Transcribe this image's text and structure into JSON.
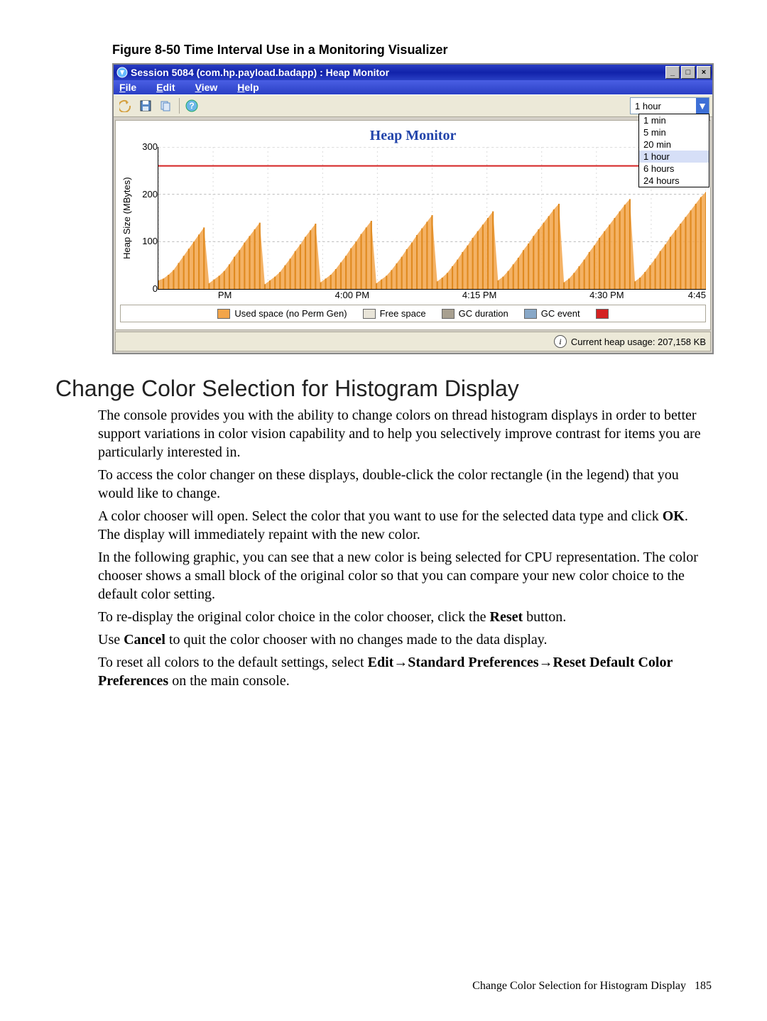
{
  "figure_caption": "Figure 8-50 Time Interval Use in a Monitoring Visualizer",
  "window": {
    "title": "Session 5084 (com.hp.payload.badapp) : Heap Monitor",
    "menu": {
      "file": "File",
      "edit": "Edit",
      "view": "View",
      "help": "Help"
    },
    "time_selected": "1 hour",
    "time_options": [
      "1 min",
      "5 min",
      "20 min",
      "1 hour",
      "6 hours",
      "24 hours"
    ],
    "status": "Current heap usage: 207,158 KB"
  },
  "chart_data": {
    "type": "line",
    "title": "Heap Monitor",
    "ylabel": "Heap Size (MBytes)",
    "ylim": [
      0,
      300
    ],
    "yticks": [
      300,
      200,
      100,
      0
    ],
    "xticks": [
      "PM",
      "4:00 PM",
      "4:15 PM",
      "4:30 PM",
      "4:45"
    ],
    "reference_line": 260,
    "legend": [
      {
        "name": "Used space (no Perm Gen)",
        "color": "#f2a54a"
      },
      {
        "name": "Free space",
        "color": "#e8e4d8"
      },
      {
        "name": "GC duration",
        "color": "#a8a090"
      },
      {
        "name": "GC event",
        "color": "#88a8c8"
      },
      {
        "name": "",
        "color": "#d42222"
      }
    ],
    "series_used_samples": [
      18,
      22,
      30,
      40,
      55,
      70,
      85,
      100,
      115,
      130,
      12,
      20,
      28,
      38,
      52,
      68,
      82,
      98,
      112,
      126,
      140,
      10,
      18,
      26,
      36,
      50,
      64,
      80,
      94,
      110,
      124,
      138,
      14,
      22,
      30,
      42,
      56,
      70,
      86,
      100,
      116,
      130,
      144,
      12,
      20,
      28,
      40,
      54,
      68,
      84,
      98,
      114,
      128,
      142,
      156,
      16,
      24,
      34,
      48,
      62,
      78,
      92,
      108,
      122,
      136,
      150,
      164,
      18,
      26,
      38,
      52,
      66,
      82,
      96,
      112,
      126,
      140,
      154,
      168,
      180,
      14,
      22,
      34,
      48,
      62,
      78,
      92,
      108,
      122,
      136,
      150,
      164,
      178,
      190,
      16,
      24,
      36,
      50,
      64,
      80,
      94,
      110,
      124,
      138,
      152,
      166,
      180,
      194,
      205
    ]
  },
  "section_heading": "Change Color Selection for Histogram Display",
  "paragraphs": {
    "p1": "The console provides you with the ability to change colors on thread histogram displays in order to better support variations in color vision capability and to help you selectively improve contrast for items you are particularly interested in.",
    "p2": "To access the color changer on these displays, double-click the color rectangle (in the legend) that you would like to change.",
    "p3a": "A color chooser will open. Select the color that you want to use for the selected data type and click ",
    "p3b": ". The display will immediately repaint with the new color.",
    "p4": "In the following graphic, you can see that a new color is being selected for CPU representation. The color chooser shows a small block of the original color so that you can compare your new color choice to the default color setting.",
    "p5a": "To re-display the original color choice in the color chooser, click the ",
    "p5b": " button.",
    "p6a": "Use ",
    "p6b": " to quit the color chooser with no changes made to the data display.",
    "p7a": "To reset all colors to the default settings, select ",
    "p7b": " on the main console.",
    "ok": "OK",
    "reset": "Reset",
    "cancel": "Cancel",
    "menu_path": "Edit→Standard Preferences→Reset Default Color Preferences"
  },
  "footer": {
    "text": "Change Color Selection for Histogram Display",
    "page": "185"
  }
}
